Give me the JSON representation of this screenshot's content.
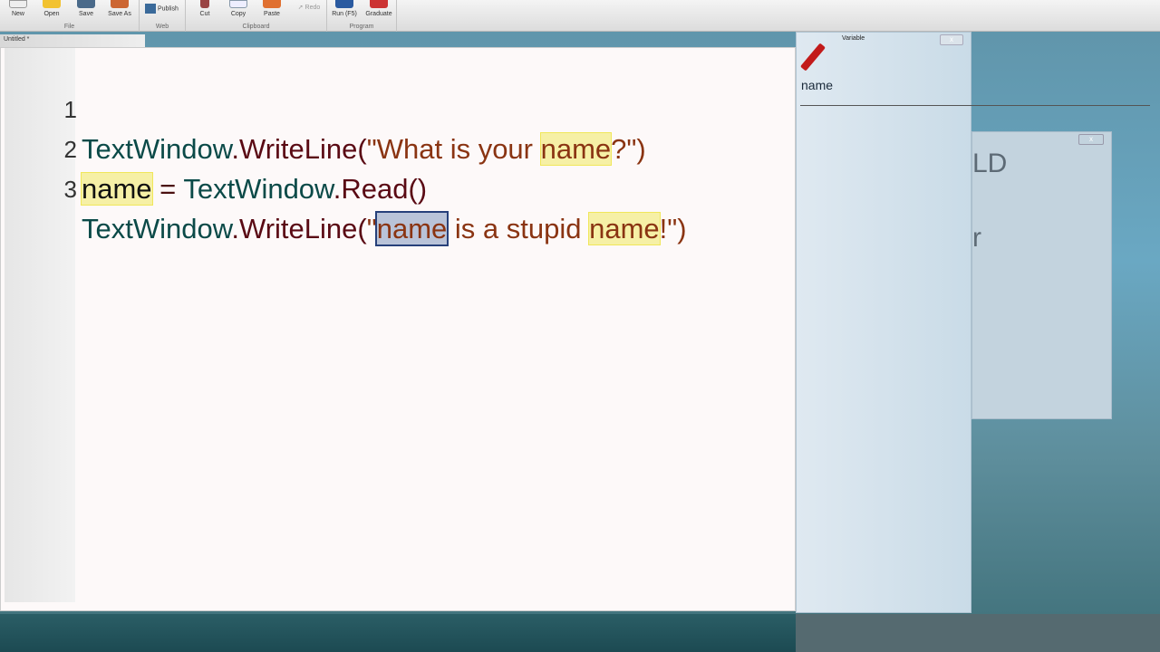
{
  "toolbar": {
    "groups": [
      {
        "label": "File",
        "buttons": [
          "New",
          "Open",
          "Save",
          "Save As"
        ]
      },
      {
        "label": "Web",
        "buttons": [
          "Publish"
        ]
      },
      {
        "label": "Clipboard",
        "buttons": [
          "Cut",
          "Copy",
          "Paste",
          "Redo"
        ]
      },
      {
        "label": "Program",
        "buttons": [
          "Run (F5)",
          "Graduate"
        ]
      }
    ]
  },
  "document": {
    "tab_title": "Untitled *"
  },
  "editor": {
    "lines": [
      {
        "n": "1",
        "parts": [
          "TextWindow",
          ".WriteLine(",
          "\"What is your ",
          "name",
          "?\")"
        ]
      },
      {
        "n": "2",
        "parts": [
          "name",
          " = ",
          "TextWindow",
          ".Read()"
        ]
      },
      {
        "n": "3",
        "parts": [
          "TextWindow",
          ".WriteLine(",
          "\"",
          "name",
          " is a stupid ",
          "name",
          "!\")"
        ]
      }
    ]
  },
  "variable_panel": {
    "title": "Variable",
    "close": "x",
    "items": [
      "name"
    ]
  },
  "background_window": {
    "close": "x",
    "text1": "LD",
    "text2": "r"
  },
  "colors": {
    "editor_bg": "#fdf9f9",
    "highlight": "#f6f0a6",
    "selection": "#b9c3d8"
  }
}
